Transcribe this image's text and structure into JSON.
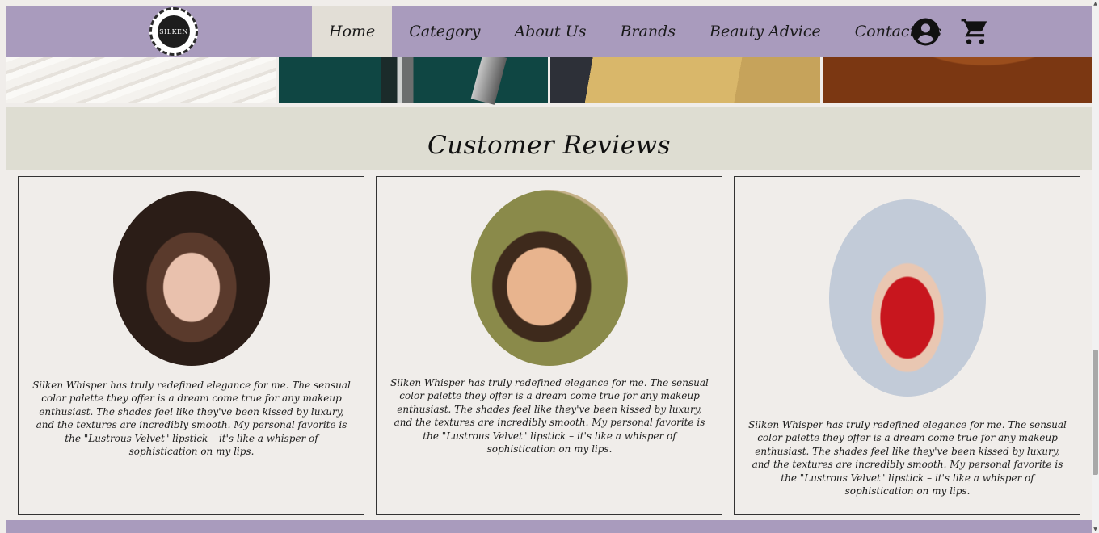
{
  "nav": {
    "logo_text": "SILKEN",
    "items": [
      {
        "label": "Home",
        "active": true
      },
      {
        "label": "Category"
      },
      {
        "label": "About Us"
      },
      {
        "label": "Brands"
      },
      {
        "label": "Beauty Advice"
      },
      {
        "label": "Contact Us"
      }
    ],
    "icons": [
      "account-circle-icon",
      "shopping-cart-icon"
    ],
    "bg_color": "#a99bbd",
    "active_bg_color": "#e2ded6"
  },
  "reviews": {
    "title": "Customer Reviews",
    "cards": [
      {
        "text": "Silken Whisper has truly redefined elegance for me. The sensual color palette they offer is a dream come true for any makeup enthusiast. The shades feel like they've been kissed by luxury, and the textures are incredibly smooth. My personal favorite is the \"Lustrous Velvet\" lipstick – it's like a whisper of sophistication on my lips."
      },
      {
        "text": "Silken Whisper has truly redefined elegance for me. The sensual color palette they offer is a dream come true for any makeup enthusiast. The shades feel like they've been kissed by luxury, and the textures are incredibly smooth. My personal favorite is the \"Lustrous Velvet\" lipstick – it's like a whisper of sophistication on my lips."
      },
      {
        "text": "Silken Whisper has truly redefined elegance for me. The sensual color palette they offer is a dream come true for any makeup enthusiast. The shades feel like they've been kissed by luxury, and the textures are incredibly smooth. My personal favorite is the \"Lustrous Velvet\" lipstick – it's like a whisper of sophistication on my lips."
      }
    ]
  }
}
